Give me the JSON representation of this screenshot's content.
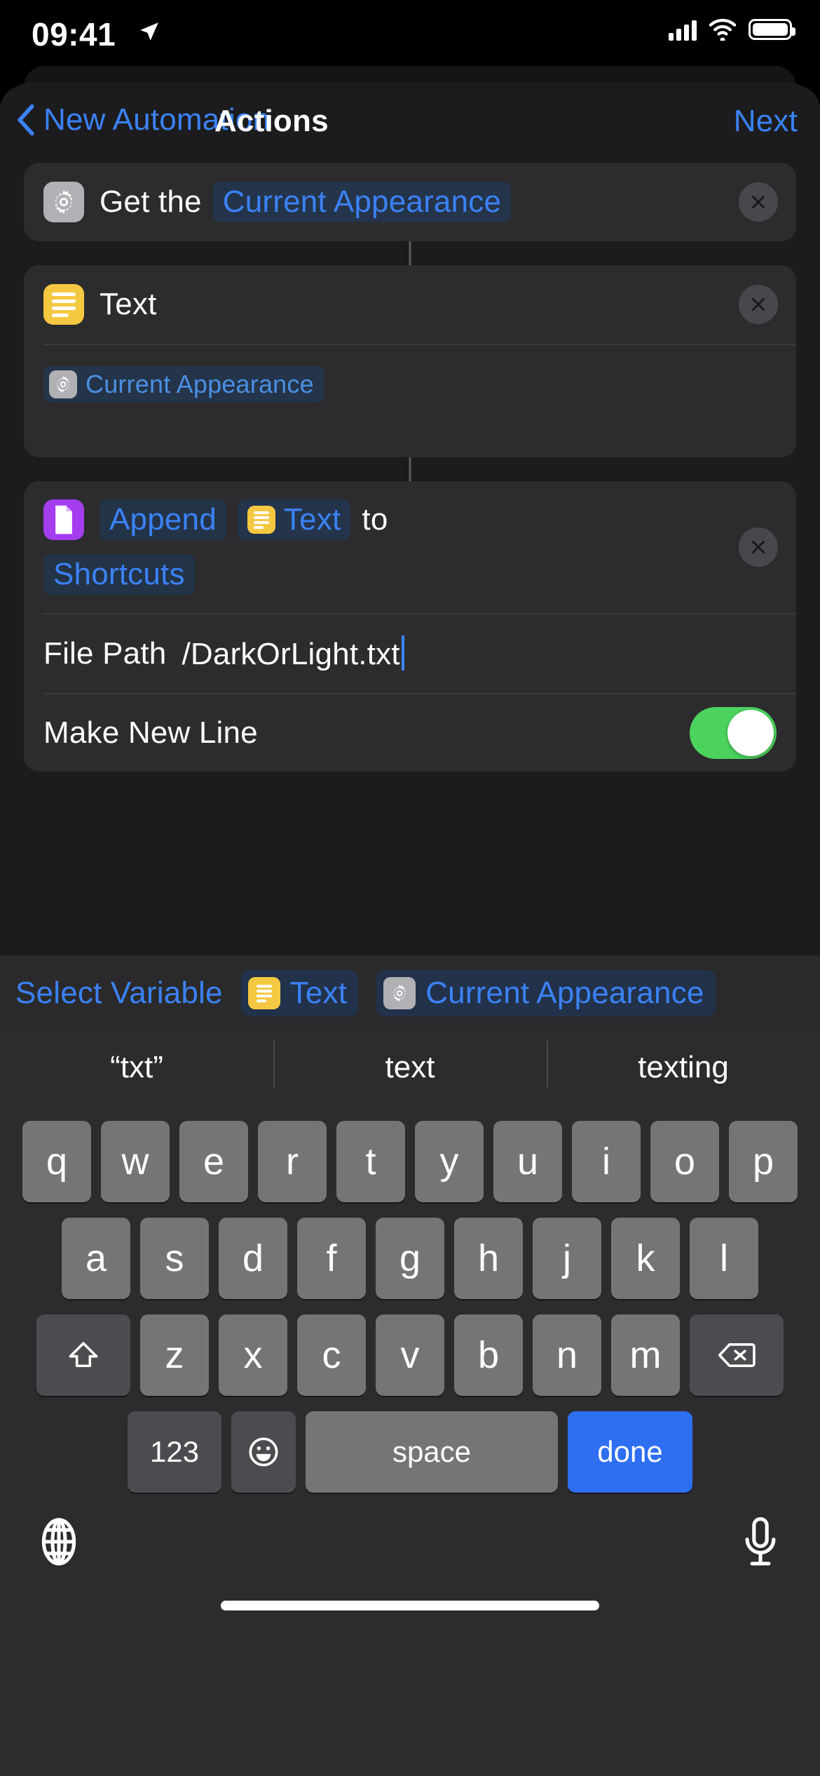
{
  "status_bar": {
    "time": "09:41",
    "location_icon": "location-arrow-icon",
    "signal_icon": "cellular-signal-icon",
    "wifi_icon": "wifi-icon",
    "battery_icon": "battery-icon"
  },
  "nav": {
    "back_icon": "chevron-left-icon",
    "back_label": "New Automation",
    "title": "Actions",
    "next_label": "Next"
  },
  "actions": [
    {
      "icon": "gear-icon",
      "icon_color": "#b0b0b5",
      "prefix": "Get the",
      "parameter": "Current Appearance",
      "remove_icon": "close-icon"
    },
    {
      "icon": "text-lines-icon",
      "icon_color": "#f5c842",
      "title": "Text",
      "remove_icon": "close-icon",
      "body_variable": {
        "icon": "gear-icon",
        "label": "Current Appearance"
      }
    },
    {
      "icon": "document-icon",
      "icon_color": "#a43cf0",
      "token_append": "Append",
      "token_text": "Text",
      "token_text_icon": "text-lines-icon",
      "connector_word": "to",
      "token_service": "Shortcuts",
      "remove_icon": "close-icon",
      "rows": [
        {
          "label": "File Path",
          "value": "/DarkOrLight.txt",
          "type": "text-field",
          "focused": true
        },
        {
          "label": "Make New Line",
          "type": "toggle",
          "toggle_on": true
        }
      ]
    }
  ],
  "variable_bar": {
    "select_label": "Select Variable",
    "chips": [
      {
        "icon": "text-lines-icon",
        "label": "Text"
      },
      {
        "icon": "gear-icon",
        "label": "Current Appearance"
      }
    ]
  },
  "keyboard": {
    "suggestions": [
      "“txt”",
      "text",
      "texting"
    ],
    "row1": [
      "q",
      "w",
      "e",
      "r",
      "t",
      "y",
      "u",
      "i",
      "o",
      "p"
    ],
    "row2": [
      "a",
      "s",
      "d",
      "f",
      "g",
      "h",
      "j",
      "k",
      "l"
    ],
    "row3": [
      "z",
      "x",
      "c",
      "v",
      "b",
      "n",
      "m"
    ],
    "shift_icon": "shift-icon",
    "backspace_icon": "backspace-icon",
    "numbers_key": "123",
    "emoji_icon": "emoji-icon",
    "space_key": "space",
    "done_key": "done",
    "globe_icon": "globe-icon",
    "mic_icon": "microphone-icon"
  },
  "colors": {
    "accent_blue": "#3b82f6",
    "toggle_green": "#4cd35e",
    "done_blue": "#2e6ff2",
    "card_bg": "#2c2c2e",
    "sheet_bg": "#1c1c1e"
  }
}
